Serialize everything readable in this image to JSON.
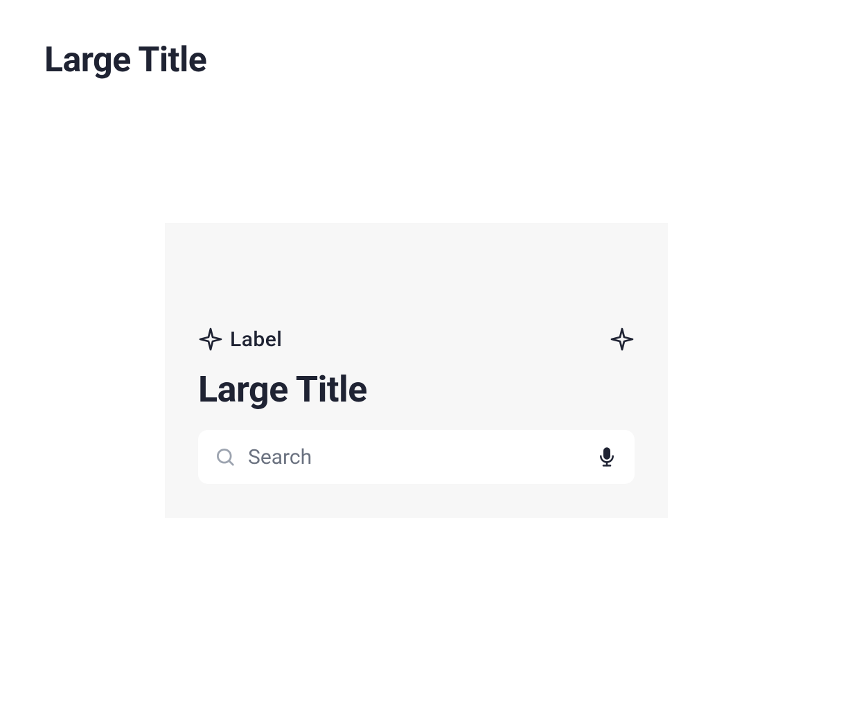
{
  "page": {
    "title": "Large Title"
  },
  "card": {
    "label": "Label",
    "title": "Large Title",
    "search": {
      "placeholder": "Search"
    }
  }
}
